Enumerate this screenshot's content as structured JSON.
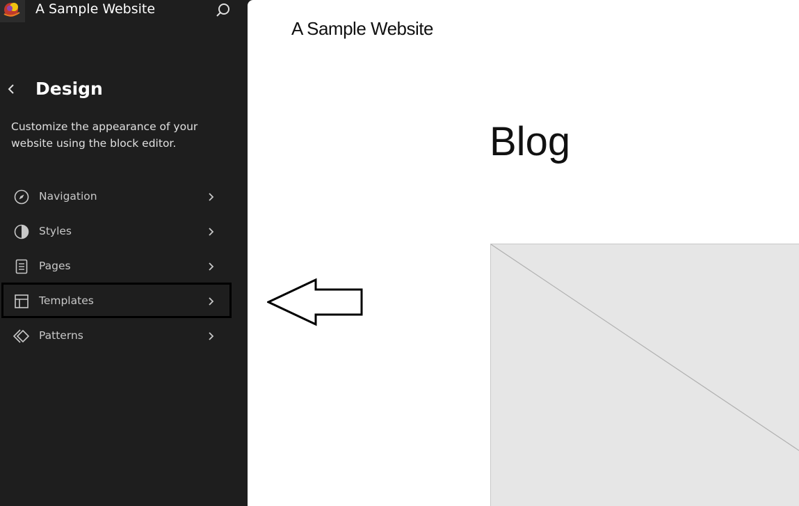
{
  "header": {
    "site_title": "A Sample Website",
    "logo_icon": "site-logo-icon",
    "search_icon": "search-icon"
  },
  "panel": {
    "title": "Design",
    "description": "Customize the appearance of your website using the block editor.",
    "back_icon": "chevron-left-icon",
    "items": [
      {
        "label": "Navigation",
        "icon": "compass-icon"
      },
      {
        "label": "Styles",
        "icon": "half-circle-icon"
      },
      {
        "label": "Pages",
        "icon": "page-icon"
      },
      {
        "label": "Templates",
        "icon": "layout-icon",
        "highlighted": true
      },
      {
        "label": "Patterns",
        "icon": "diamond-icon"
      }
    ]
  },
  "canvas": {
    "site_title": "A Sample Website",
    "page_heading": "Blog"
  },
  "annotation": {
    "type": "arrow-left",
    "points_to": "Templates",
    "color": "#000000"
  },
  "colors": {
    "sidebar_bg": "#1e1e1e",
    "canvas_bg": "#ffffff",
    "placeholder_bg": "#e6e6e6"
  }
}
